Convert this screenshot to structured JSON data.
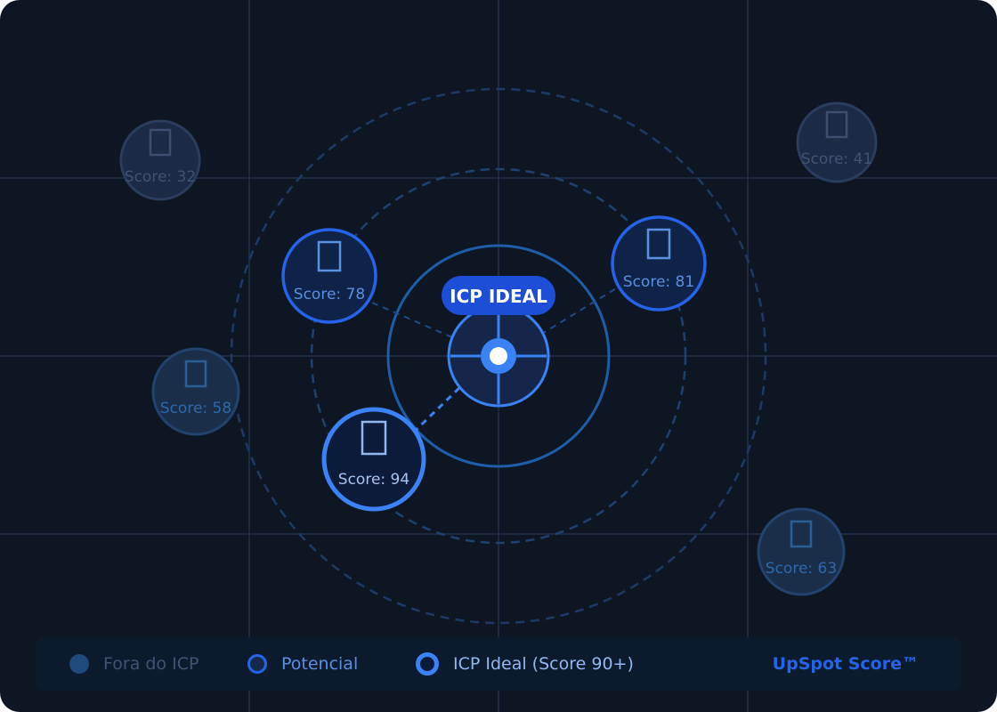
{
  "center": {
    "label": "ICP IDEAL"
  },
  "nodes": [
    {
      "id": "top-left-far",
      "tier": "out",
      "icon": "building-icon",
      "score_label": "Score: 32"
    },
    {
      "id": "top-right-far",
      "tier": "out",
      "icon": "building-icon",
      "score_label": "Score: 41"
    },
    {
      "id": "mid-left-far",
      "tier": "out-near",
      "icon": "building-icon",
      "score_label": "Score: 58"
    },
    {
      "id": "bottom-right-far",
      "tier": "out-near",
      "icon": "building-icon",
      "score_label": "Score: 63"
    },
    {
      "id": "potential-left",
      "tier": "potential",
      "icon": "building-icon",
      "score_label": "Score: 78"
    },
    {
      "id": "potential-right",
      "tier": "potential",
      "icon": "building-icon",
      "score_label": "Score: 81"
    },
    {
      "id": "ideal",
      "tier": "ideal",
      "icon": "building-icon",
      "score_label": "Score: 94"
    }
  ],
  "legend": {
    "out_label": "Fora do ICP",
    "potential_label": "Potencial",
    "ideal_label": "ICP Ideal (Score 90+)",
    "brand": "UpSpot Score™"
  },
  "colors": {
    "background": "#0e1623",
    "grid": "#1c2a40",
    "accent": "#3b82f6",
    "accent_dark": "#1d4ed8",
    "muted_node": "#1e2d48",
    "brand": "#2563eb"
  }
}
